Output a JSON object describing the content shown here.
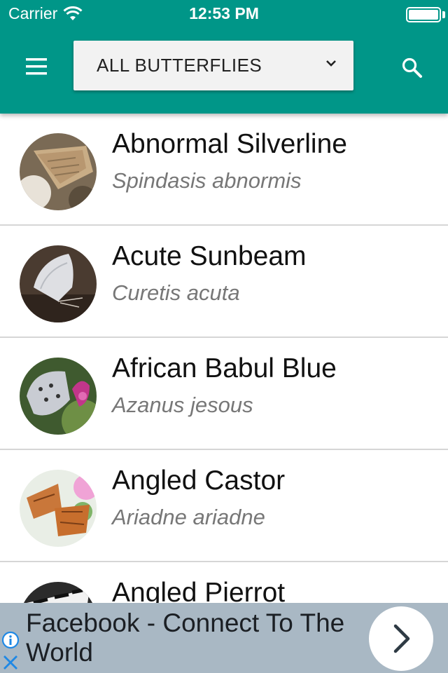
{
  "status_bar": {
    "carrier": "Carrier",
    "time": "12:53 PM"
  },
  "toolbar": {
    "menu_icon": "hamburger-menu-icon",
    "filter_label": "ALL BUTTERFLIES",
    "search_icon": "search-icon",
    "accent_color": "#009688"
  },
  "butterflies": [
    {
      "common_name": "Abnormal Silverline",
      "scientific_name": "Spindasis abnormis"
    },
    {
      "common_name": "Acute Sunbeam",
      "scientific_name": "Curetis acuta"
    },
    {
      "common_name": "African Babul Blue",
      "scientific_name": "Azanus jesous"
    },
    {
      "common_name": "Angled Castor",
      "scientific_name": "Ariadne ariadne"
    },
    {
      "common_name": "Angled Pierrot",
      "scientific_name": ""
    }
  ],
  "ad": {
    "text": "Facebook - Connect To The World",
    "background_color": "#a9b8c4"
  }
}
